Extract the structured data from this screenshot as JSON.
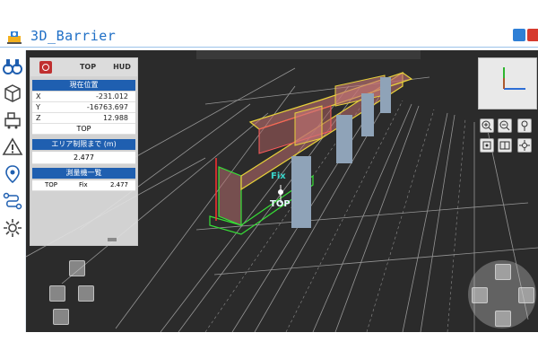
{
  "window": {
    "title": "3D_Barrier"
  },
  "panel": {
    "tabs": {
      "top": "TOP",
      "hud": "HUD"
    },
    "position_header": "現在位置",
    "coords": [
      {
        "key": "X",
        "value": "-231.012"
      },
      {
        "key": "Y",
        "value": "-16763.697"
      },
      {
        "key": "Z",
        "value": "12.988"
      }
    ],
    "reference": "TOP",
    "area_header": "エリア制限まで (m)",
    "area_value": "2.477",
    "survey_header": "測量機一覧",
    "survey_row": {
      "name": "TOP",
      "status": "Fix",
      "value": "2.477"
    }
  },
  "scene_labels": {
    "fix": "Fix",
    "top": "TOP"
  },
  "icons": {
    "app": "app-logo-icon",
    "max": "maximize-icon",
    "close": "close-icon"
  },
  "colors": {
    "title": "#1f6fc6",
    "panel_header": "#1f5fb0",
    "viewport": "#2b2b2b",
    "close": "#d63a2e"
  }
}
